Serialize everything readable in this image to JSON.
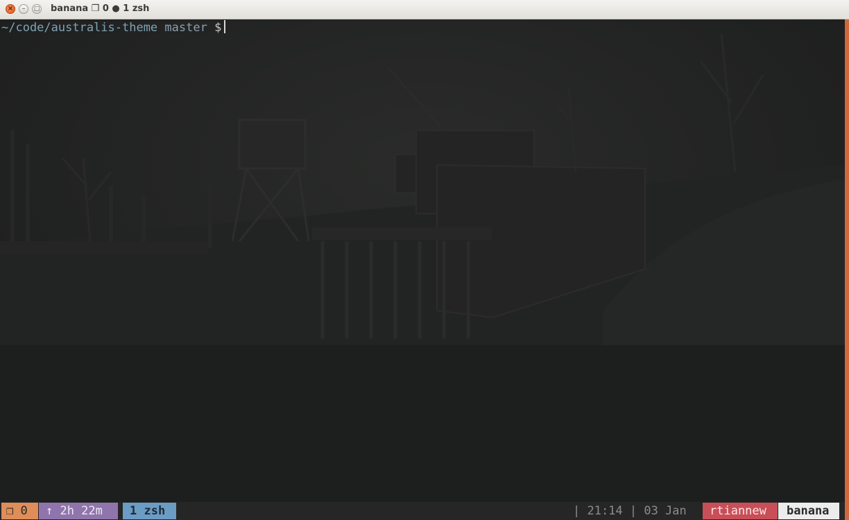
{
  "window": {
    "title": "banana ❒ 0 ● 1 zsh",
    "close_glyph": "×",
    "minimize_glyph": "–",
    "maximize_glyph": "□"
  },
  "terminal": {
    "path": "~/code/australis-theme",
    "branch": "master",
    "symbol": "$"
  },
  "statusbar": {
    "windows": "❒ 0",
    "uptime": "↑ 2h 22m",
    "active_window": "1 zsh",
    "clock": "| 21:14 | 03 Jan",
    "user": "rtiannew",
    "host": "banana"
  },
  "colors": {
    "accent_orange": "#df8e59",
    "accent_purple": "#8f75ac",
    "accent_blue": "#6b9cc4",
    "accent_red": "#c84f57",
    "terminal_bg": "#1f2020"
  }
}
